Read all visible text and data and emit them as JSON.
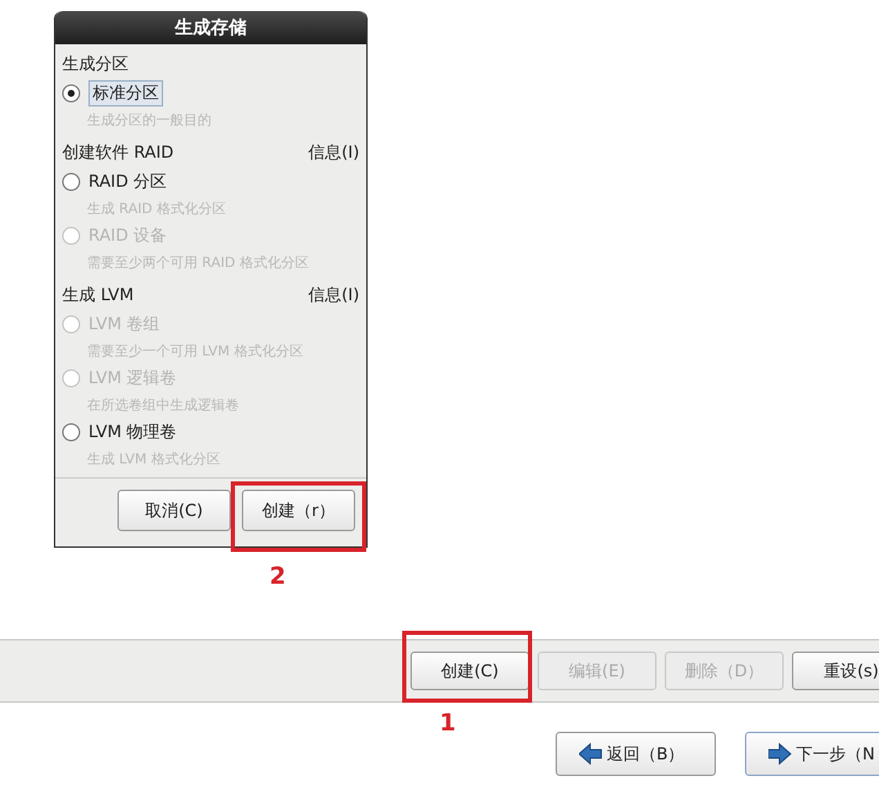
{
  "dialog": {
    "title": "生成存储",
    "sections": [
      {
        "heading": "生成分区",
        "options": [
          {
            "label": "标准分区",
            "description": "生成分区的一般目的",
            "selected": true,
            "disabled": false
          }
        ]
      },
      {
        "heading": "创建软件 RAID",
        "info": "信息(I)",
        "options": [
          {
            "label": "RAID 分区",
            "description": "生成 RAID 格式化分区",
            "selected": false,
            "disabled": false
          },
          {
            "label": "RAID 设备",
            "description": "需要至少两个可用 RAID 格式化分区",
            "selected": false,
            "disabled": true
          }
        ]
      },
      {
        "heading": "生成 LVM",
        "info": "信息(I)",
        "options": [
          {
            "label": "LVM 卷组",
            "description": "需要至少一个可用 LVM 格式化分区",
            "selected": false,
            "disabled": true
          },
          {
            "label": "LVM 逻辑卷",
            "description": "在所选卷组中生成逻辑卷",
            "selected": false,
            "disabled": true
          },
          {
            "label": "LVM 物理卷",
            "description": "生成 LVM 格式化分区",
            "selected": false,
            "disabled": false
          }
        ]
      }
    ],
    "buttons": [
      "取消(C)",
      "创建（r）"
    ]
  },
  "toolbar": {
    "buttons": [
      {
        "label": "创建(C)",
        "disabled": false
      },
      {
        "label": "编辑(E)",
        "disabled": true
      },
      {
        "label": "删除（D）",
        "disabled": true
      },
      {
        "label": "重设(s)",
        "disabled": false
      }
    ]
  },
  "navigation": [
    {
      "label": "返回（B）",
      "kind": "back"
    },
    {
      "label": "下一步（N",
      "kind": "next"
    }
  ],
  "annotations": [
    {
      "label": "2",
      "kind": "dialog"
    },
    {
      "label": "1",
      "kind": "toolbar"
    }
  ]
}
